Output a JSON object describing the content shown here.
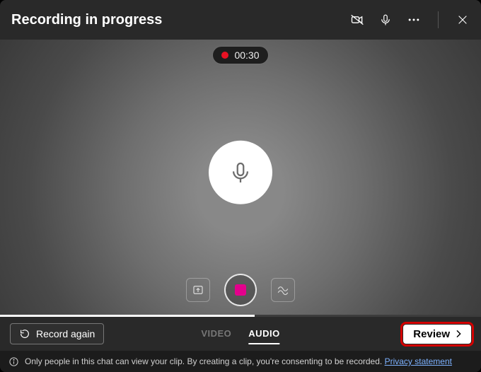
{
  "title": "Recording in progress",
  "timer": "00:30",
  "controls": {
    "upload_tooltip": "Upload",
    "stop_tooltip": "Stop recording",
    "effects_tooltip": "Background effects"
  },
  "bottombar": {
    "record_again_label": "Record again",
    "tabs": {
      "video": "VIDEO",
      "audio": "AUDIO"
    },
    "review_label": "Review"
  },
  "footer": {
    "text": "Only people in this chat can view your clip. By creating a clip, you're consenting to be recorded. ",
    "privacy_link": "Privacy statement"
  }
}
